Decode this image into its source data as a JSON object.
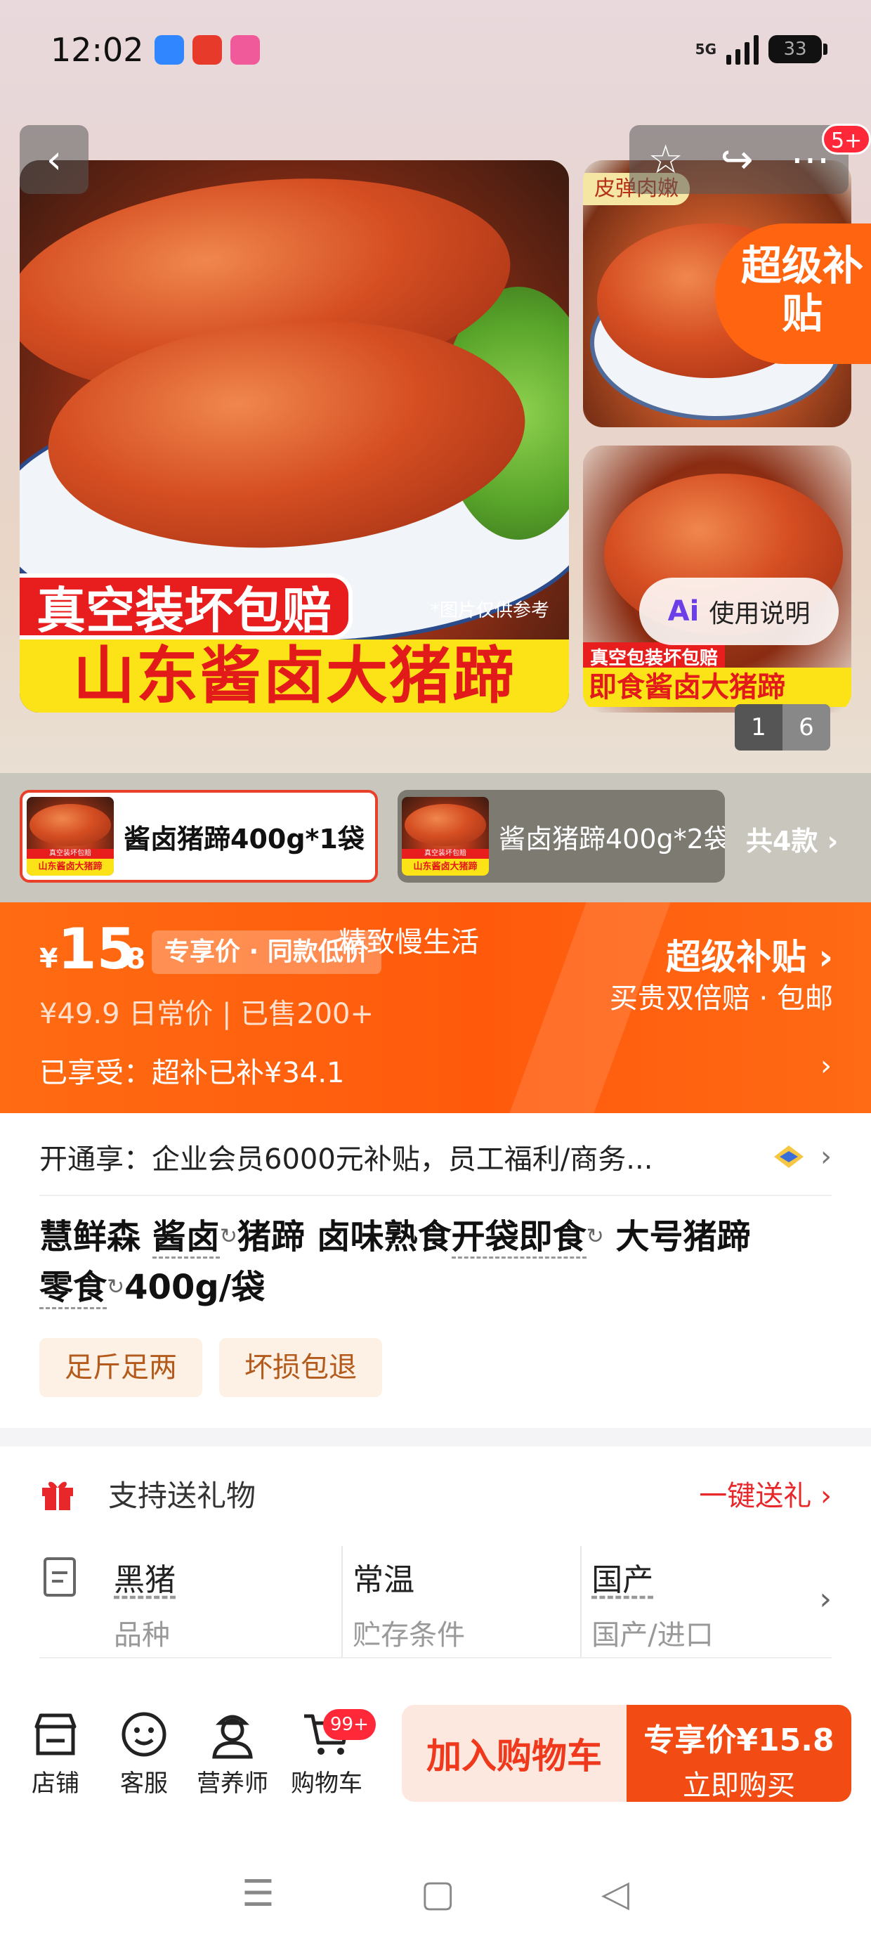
{
  "status_bar": {
    "time": "12:02",
    "network": "5G",
    "battery": "33"
  },
  "gallery": {
    "back_icon": "chevron-left-icon",
    "actions": [
      "star-icon",
      "share-icon",
      "more-icon"
    ],
    "notification_badge": "5+",
    "main_banner_top": "真空装坏包赔",
    "main_banner_note": "*图片仅供参考",
    "main_banner_bottom": "山东酱卤大猪蹄",
    "side_tag": "皮弹肉嫩",
    "side_banner_top": "真空包装坏包赔",
    "side_banner_bottom": "即食酱卤大猪蹄",
    "super_subsidy": "超级补贴",
    "use_guide": "使用说明",
    "counter_current": "1",
    "counter_total": "6"
  },
  "variants": {
    "items": [
      {
        "label": "酱卤猪蹄400g*1袋",
        "thumb_top": "真空装坏包赔",
        "thumb_bottom": "山东酱卤大猪蹄"
      },
      {
        "label": "酱卤猪蹄400g*2袋",
        "thumb_top": "真空装坏包赔",
        "thumb_bottom": "山东酱卤大猪蹄"
      }
    ],
    "count_label": "共4款 ›"
  },
  "price": {
    "currency": "¥",
    "integer": "15",
    "decimal": ".8",
    "exclusive_label": "专享价 · 同款低价",
    "shop_overlay": "精致慢生活",
    "subsidy_title": "超级补贴 ›",
    "subsidy_desc": "买贵双倍赔 · 包邮",
    "original_price": "¥49.9  日常价 | 已售200+",
    "enjoyed": "已享受：超补已补¥34.1",
    "accent_color": "#ff5a0c"
  },
  "member": {
    "text": "开通享：企业会员6000元补贴，员工福利/商务..."
  },
  "product": {
    "brand": "慧鲜森 ",
    "kw1": "酱卤",
    "mid1": "猪蹄 卤味熟食",
    "kw2": "开袋即食",
    "mid2": " 大号猪蹄",
    "kw3": "零食",
    "tail": "400g/袋",
    "tags": [
      "足斤足两",
      "坏损包退"
    ]
  },
  "gift": {
    "label": "支持送礼物",
    "link": "一键送礼 ›"
  },
  "specs": [
    {
      "value": "黑猪",
      "key": "品种",
      "linked": true
    },
    {
      "value": "常温",
      "key": "贮存条件",
      "linked": false
    },
    {
      "value": "国产",
      "key": "国产/进口",
      "linked": true
    }
  ],
  "bottom_nav": {
    "items": [
      {
        "label": "店铺",
        "icon": "store-icon"
      },
      {
        "label": "客服",
        "icon": "customer-service-icon"
      },
      {
        "label": "营养师",
        "icon": "nutritionist-icon"
      },
      {
        "label": "购物车",
        "icon": "cart-icon"
      }
    ],
    "cart_badge": "99+",
    "add_to_cart": "加入购物车",
    "buy_price": "专享价¥15.8",
    "buy_label": "立即购买"
  }
}
